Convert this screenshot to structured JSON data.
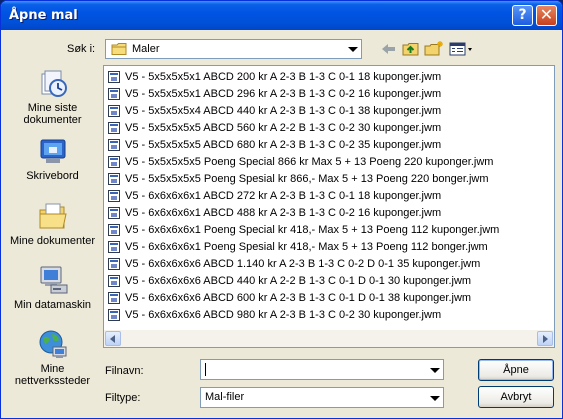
{
  "window": {
    "title": "Åpne mal",
    "help_label": "?",
    "close_label": "✕"
  },
  "lookin": {
    "label": "Søk i:",
    "value": "Maler",
    "folder_icon": "folder-icon"
  },
  "toolbar": {
    "back_icon": "back-arrow-icon",
    "up_icon": "up-one-level-icon",
    "newfolder_icon": "new-folder-icon",
    "views_icon": "views-menu-icon"
  },
  "places": [
    {
      "label": "Mine siste dokumenter",
      "icon": "recent-documents-icon"
    },
    {
      "label": "Skrivebord",
      "icon": "desktop-icon"
    },
    {
      "label": "Mine dokumenter",
      "icon": "my-documents-icon"
    },
    {
      "label": "Min datamaskin",
      "icon": "my-computer-icon"
    },
    {
      "label": "Mine nettverkssteder",
      "icon": "network-places-icon"
    }
  ],
  "files": [
    "V5 - 5x5x5x5x1 ABCD 200 kr A 2-3 B 1-3 C 0-1 18 kuponger.jwm",
    "V5 - 5x5x5x5x1 ABCD 296 kr A 2-3 B 1-3 C 0-2 16 kuponger.jwm",
    "V5 - 5x5x5x5x4 ABCD 440 kr A 2-3 B 1-3 C 0-1 38 kuponger.jwm",
    "V5 - 5x5x5x5x5 ABCD 560 kr A 2-2 B 1-3 C 0-2 30 kuponger.jwm",
    "V5 - 5x5x5x5x5 ABCD 680 kr A 2-3 B 1-3 C 0-2 35 kuponger.jwm",
    "V5 - 5x5x5x5x5 Poeng Special 866 kr  Max 5 + 13 Poeng 220 kuponger.jwm",
    "V5 - 5x5x5x5x5 Poeng Spesial kr 866,-  Max 5 + 13 Poeng 220 bonger.jwm",
    "V5 - 6x6x6x6x1 ABCD 272 kr A 2-3 B 1-3 C 0-1 18 kuponger.jwm",
    "V5 - 6x6x6x6x1 ABCD 488 kr A 2-3 B 1-3 C 0-2 16 kuponger.jwm",
    "V5 - 6x6x6x6x1 Poeng Special kr 418,-  Max 5 + 13 Poeng 112 kuponger.jwm",
    "V5 - 6x6x6x6x1 Poeng Spesial kr 418,-  Max 5 + 13 Poeng 112 bonger.jwm",
    "V5 - 6x6x6x6x6 ABCD 1.140 kr A 2-3 B 1-3 C 0-2 D 0-1 35 kuponger.jwm",
    "V5 - 6x6x6x6x6 ABCD 440 kr A 2-2 B 1-3 C 0-1 D 0-1 30 kuponger.jwm",
    "V5 - 6x6x6x6x6 ABCD 600 kr A 2-3 B 1-3 C 0-1 D 0-1 38 kuponger.jwm",
    "V5 - 6x6x6x6x6 ABCD 980 kr A 2-3 B 1-3 C 0-2 30 kuponger.jwm"
  ],
  "filename": {
    "label": "Filnavn:",
    "value": ""
  },
  "filetype": {
    "label": "Filtype:",
    "value": "Mal-filer"
  },
  "buttons": {
    "open": "Åpne",
    "cancel": "Avbryt"
  }
}
